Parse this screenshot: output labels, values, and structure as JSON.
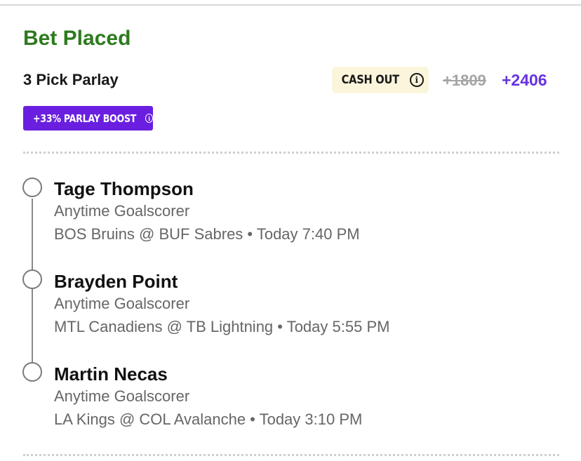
{
  "header": {
    "title": "Bet Placed",
    "bet_type": "3 Pick Parlay",
    "cash_out_label": "CASH OUT",
    "info_glyph": "i",
    "original_odds": "+1809",
    "boosted_odds": "+2406",
    "boost_badge": "+33% PARLAY BOOST"
  },
  "legs": [
    {
      "player": "Tage Thompson",
      "market": "Anytime Goalscorer",
      "game": "BOS Bruins @ BUF Sabres • Today 7:40 PM"
    },
    {
      "player": "Brayden Point",
      "market": "Anytime Goalscorer",
      "game": "MTL Canadiens @ TB Lightning • Today 5:55 PM"
    },
    {
      "player": "Martin Necas",
      "market": "Anytime Goalscorer",
      "game": "LA Kings @ COL Avalanche • Today 3:10 PM"
    }
  ],
  "colors": {
    "title_green": "#2e7a1f",
    "boost_purple": "#6a1fe0",
    "odds_purple": "#6633e0",
    "cashout_bg": "#fbf5dc"
  },
  "icons": {
    "cash_out_info": "info-circle-icon",
    "boost_info": "info-circle-icon",
    "leg_status": "empty-circle-icon"
  }
}
